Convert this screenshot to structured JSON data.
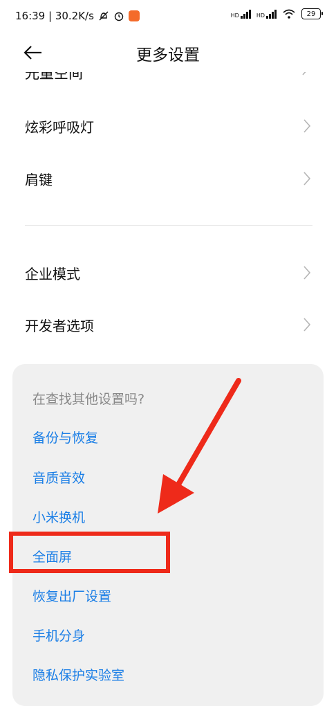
{
  "status_bar": {
    "time_speed": "16:39 | 30.2K/s",
    "battery": "29",
    "network_1": "HD",
    "network_2": "HD"
  },
  "header": {
    "title": "更多设置"
  },
  "settings_items": [
    {
      "label": "炫彩呼吸灯"
    },
    {
      "label": "肩键"
    },
    {
      "label": "企业模式"
    },
    {
      "label": "开发者选项"
    }
  ],
  "partial_item": {
    "label": "光量空间"
  },
  "suggestions": {
    "hint": "在查找其他设置吗?",
    "links": [
      {
        "label": "备份与恢复"
      },
      {
        "label": "音质音效"
      },
      {
        "label": "小米换机"
      },
      {
        "label": "全面屏"
      },
      {
        "label": "恢复出厂设置"
      },
      {
        "label": "手机分身"
      },
      {
        "label": "隐私保护实验室"
      }
    ]
  },
  "colors": {
    "link": "#1a7ee6",
    "annotation": "#ee2a1a"
  }
}
